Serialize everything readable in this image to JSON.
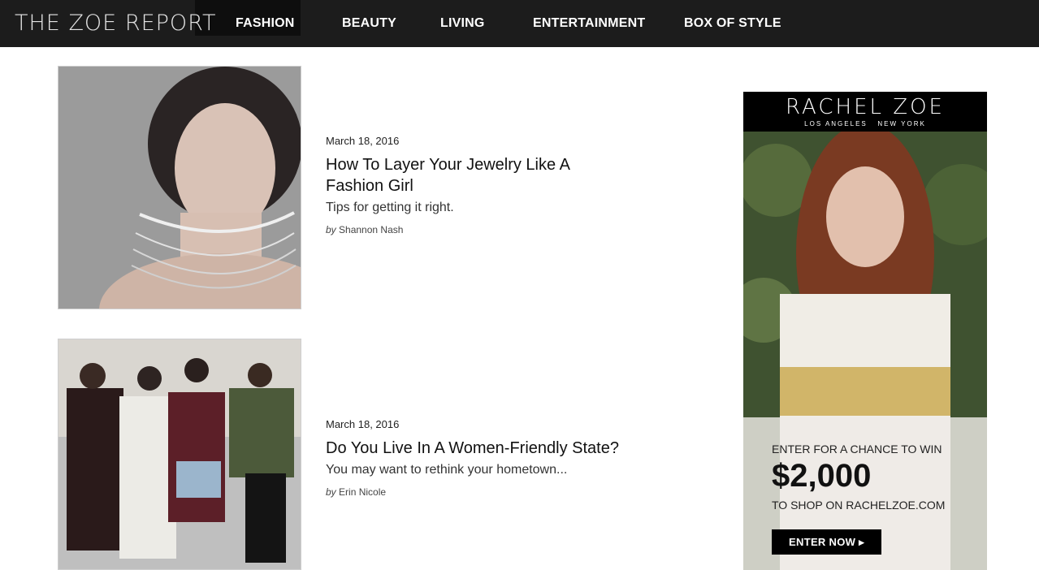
{
  "header": {
    "logo_light": "THE ZOE ",
    "logo_bold": "REPORT",
    "nav": [
      {
        "label": "FASHION"
      },
      {
        "label": "BEAUTY"
      },
      {
        "label": "LIVING"
      },
      {
        "label": "ENTERTAINMENT"
      },
      {
        "label": "BOX OF STYLE"
      }
    ]
  },
  "articles": [
    {
      "date": "March 18, 2016",
      "title_line1": "How To Layer Your Jewelry Like A",
      "title_line2": "Fashion Girl",
      "dek": "Tips for getting it right.",
      "by": "by",
      "author": "Shannon Nash"
    },
    {
      "date": "March 18, 2016",
      "title_line1": "Do You Live In A Women-Friendly State?",
      "title_line2": "",
      "dek": "You may want to rethink your hometown...",
      "by": "by",
      "author": "Erin Nicole"
    }
  ],
  "ad": {
    "brand": "RACHEL ZOE",
    "brand_sub": "LOS ANGELES   NEW YORK",
    "line1": "ENTER FOR A CHANCE TO WIN",
    "amount": "$2,000",
    "line2": "TO SHOP ON RACHELZOE.COM",
    "cta": "ENTER NOW ▸"
  },
  "colors": {
    "nav_bg": "#1c1c1c",
    "cta_bg": "#000000"
  }
}
